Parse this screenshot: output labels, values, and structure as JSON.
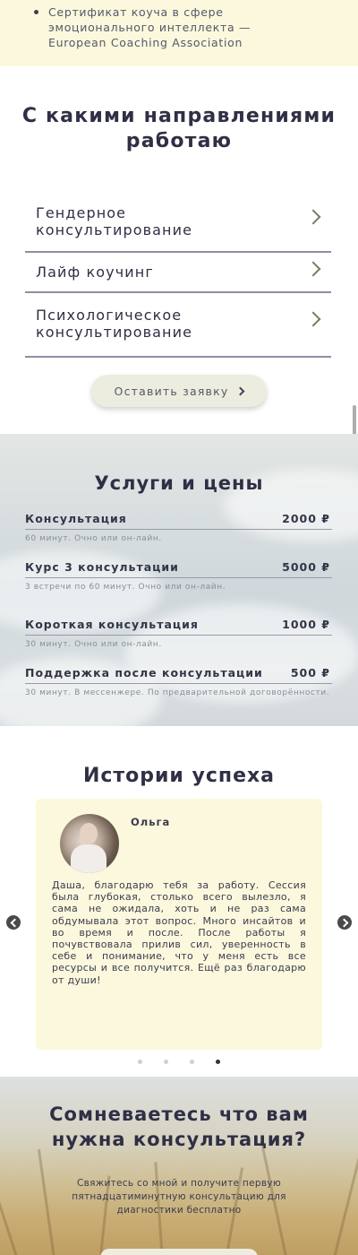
{
  "certificate": {
    "text": "Сертификат коуча в сфере\nэмоционального интеллекта —\nEuropean Coaching Association"
  },
  "directions": {
    "title": "С какими направлениями\nработаю",
    "items": [
      {
        "label": "Гендерное\nконсультирование"
      },
      {
        "label": "Лайф коучинг"
      },
      {
        "label": "Психологическое\nконсультирование"
      }
    ],
    "button_label": "Оставить заявку"
  },
  "services": {
    "title": "Услуги и цены",
    "items": [
      {
        "name": "Консультация",
        "price": "2000 ₽",
        "desc": "60 минут. Очно или он-лайн."
      },
      {
        "name": "Курс 3 консультации",
        "price": "5000 ₽",
        "desc": "3 встречи по 60 минут. Очно или он-лайн."
      },
      {
        "name": "Короткая консультация",
        "price": "1000 ₽",
        "desc": "30 минут. Очно или он-лайн."
      },
      {
        "name": "Поддержка после консультации",
        "price": "500 ₽",
        "desc": "30 минут. В мессенжере. По предварительной договорённости."
      }
    ]
  },
  "stories": {
    "title": "Истории успеха",
    "author": "Ольга",
    "quote": "Даша, благодарю тебя за работу. Сессия была глубокая, столько всего вылезло, я сама не ожидала, хоть и не раз сама обдумывала этот вопрос. Много инсайтов и во время и после. После работы я почувствовала прилив сил, уверенность в себе и понимание, что у меня есть все ресурсы и все получится. Ещё раз благодарю от души!",
    "slides_total": 4,
    "active_slide": 4
  },
  "cta": {
    "title": "Сомневаетесь что вам\nнужна консультация?",
    "subtitle": "Свяжитесь со мной и получите первую пятнадцатиминутную консультацию для диагностики бесплатно"
  },
  "colors": {
    "accent_bg": "#fbf8dd",
    "text_dark": "#2f2f45",
    "chevron": "#7c7b60"
  }
}
